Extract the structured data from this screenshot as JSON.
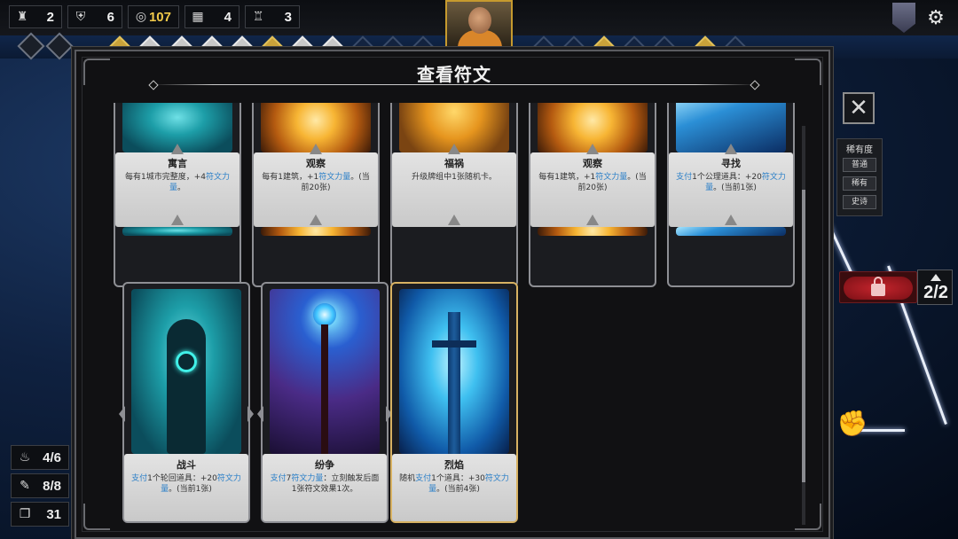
{
  "top_bar": {
    "resources": [
      {
        "icon": "tower-icon",
        "value": "2"
      },
      {
        "icon": "shield-icon",
        "value": "6"
      },
      {
        "icon": "coins-icon",
        "value": "107",
        "color": "#f0c94a"
      },
      {
        "icon": "calendar-icon",
        "value": "4"
      },
      {
        "icon": "castle-icon",
        "value": "3"
      }
    ],
    "portrait_icon": "monk-portrait",
    "rank_icon": "emblem-shield-icon",
    "settings_icon": "gear-icon"
  },
  "left_stats": [
    {
      "icon": "bag-icon",
      "value": "4/6"
    },
    {
      "icon": "scroll-icon",
      "value": "8/8"
    },
    {
      "icon": "deck-icon",
      "value": "31"
    }
  ],
  "modal": {
    "title": "查看符文",
    "close_icon": "close-icon",
    "cards_row1": [
      {
        "name": "寓言",
        "desc_parts": [
          "每有1城市完整度，+4",
          "符文力量",
          "。"
        ],
        "art": "teal"
      },
      {
        "name": "观察",
        "desc_parts": [
          "每有1建筑，+1",
          "符文力量",
          "。(当前20张)"
        ],
        "art": "fire"
      },
      {
        "name": "福祸",
        "desc_parts": [
          "升级牌组中1张随机卡。",
          "",
          ""
        ],
        "art": "sunset"
      },
      {
        "name": "观察",
        "desc_parts": [
          "每有1建筑，+1",
          "符文力量",
          "。(当前20张)"
        ],
        "art": "fire"
      },
      {
        "name": "寻找",
        "desc_parts": [
          "支付",
          "1个公理道具：+20",
          "符文力量",
          "。(当前1张)"
        ],
        "art": "blue"
      }
    ],
    "cards_row2": [
      {
        "name": "战斗",
        "desc_parts": [
          "支付",
          "1个轮回道具：+20",
          "符文力量",
          "。(当前1张)"
        ],
        "art": "teal-hood",
        "frame": "silver"
      },
      {
        "name": "纷争",
        "desc_parts": [
          "支付",
          "7",
          "符文力量",
          "：立刻触发后面1张符文效果1次。"
        ],
        "art": "violet-staff",
        "frame": "silver"
      },
      {
        "name": "烈焰",
        "desc_parts": [
          "随机",
          "支付",
          "1个道具：+30",
          "符文力量",
          "。(当前4张)"
        ],
        "art": "sword",
        "frame": "gold"
      }
    ]
  },
  "rarity_filter": {
    "title": "稀有度",
    "options": [
      "普通",
      "稀有",
      "史诗"
    ]
  },
  "lock_button": {
    "icon": "lock-icon",
    "color": "#c4242c"
  },
  "counter": {
    "value": "2/2"
  },
  "action_icon": "fist-icon",
  "accent_colors": {
    "keyword": "#2a7fc8",
    "gold": "#c9a23a"
  }
}
